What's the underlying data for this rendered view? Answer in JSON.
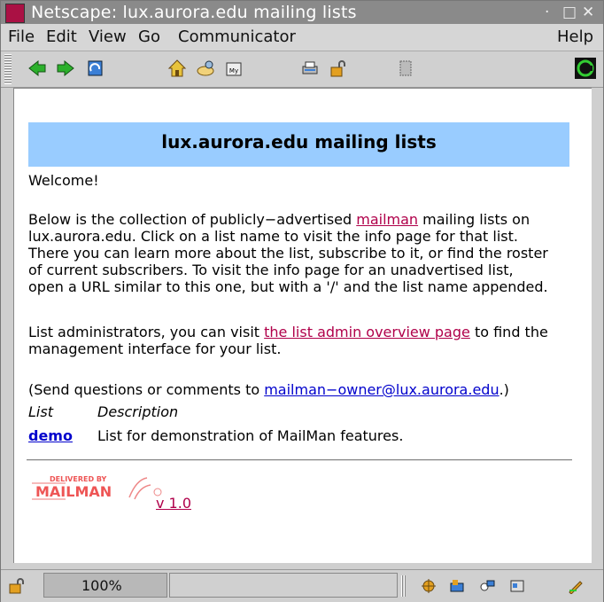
{
  "window": {
    "title": "Netscape: lux.aurora.edu mailing lists",
    "controls": [
      "·",
      "□",
      "✕"
    ]
  },
  "menu": {
    "items": [
      "File",
      "Edit",
      "View",
      "Go",
      "Communicator"
    ],
    "help": "Help"
  },
  "toolbar": {
    "icons": [
      "back-icon",
      "forward-icon",
      "reload-icon",
      "home-icon",
      "search-icon",
      "my-netscape-icon",
      "print-icon",
      "security-icon",
      "stop-icon",
      "netscape-throbber-icon"
    ]
  },
  "page": {
    "heading": "lux.aurora.edu mailing lists",
    "welcome": "Welcome!",
    "intro_before": "Below is the collection of publicly−advertised ",
    "intro_link": "mailman",
    "intro_after": " mailing lists on",
    "intro_lines": [
      "lux.aurora.edu. Click on a list name to visit the info page for that list.",
      "There you can learn more about the list, subscribe to it, or find the roster",
      "of current subscribers. To visit the info page for an unadvertised list,",
      "open a URL similar to this one, but with a '/' and the list name appended."
    ],
    "admin_before": "List administrators, you can visit ",
    "admin_link": "the list admin overview page",
    "admin_after": " to find the",
    "admin_line2": "management interface for your list.",
    "questions_before": "(Send questions or comments to ",
    "questions_link": "mailman−owner@lux.aurora.edu",
    "questions_after": ".)",
    "table": {
      "headers": [
        "List",
        "Description"
      ],
      "rows": [
        {
          "name": "demo",
          "description": "List for demonstration of MailMan features."
        }
      ]
    },
    "logo_text_top": "DELIVERED BY",
    "logo_text_main": "MAILMAN",
    "version_link": "v 1.0"
  },
  "status": {
    "zoom": "100%"
  },
  "colors": {
    "banner": "#99ccff",
    "visited_link": "#b0004a",
    "link": "#0000cc"
  }
}
